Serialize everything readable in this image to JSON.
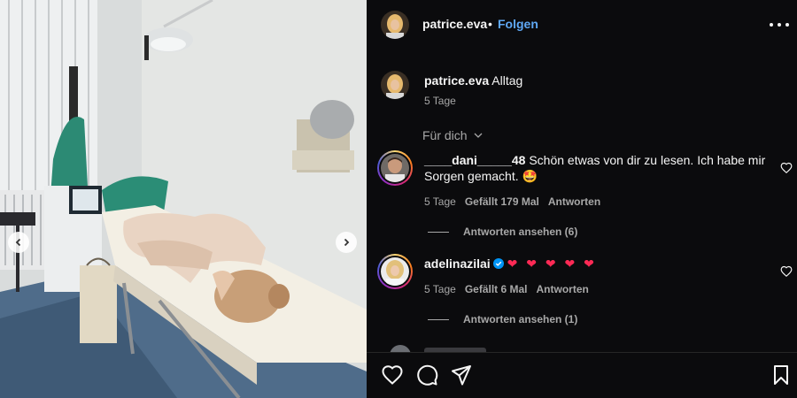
{
  "post": {
    "author": "patrice.eva",
    "follow_label": "Folgen",
    "separator": "•",
    "caption_user": "patrice.eva",
    "caption_text": "Alltag",
    "caption_age": "5 Tage"
  },
  "comments_sort": "Für dich",
  "comments": [
    {
      "user": "____dani_____48",
      "text": "Schön etwas von dir zu lesen. Ich habe mir Sorgen gemacht. 🤩",
      "age": "5 Tage",
      "likes": "Gefällt 179 Mal",
      "reply_label": "Antworten",
      "view_replies": "Antworten ansehen (6)"
    },
    {
      "user": "adelinazilai",
      "verified": true,
      "text": "❤ ❤ ❤ ❤ ❤",
      "age": "5 Tage",
      "likes": "Gefällt 6 Mal",
      "reply_label": "Antworten",
      "view_replies": "Antworten ansehen (1)"
    }
  ],
  "icons": {
    "more": "more-options-icon",
    "like": "heart-icon",
    "comment": "comment-icon",
    "share": "send-icon",
    "save": "bookmark-icon",
    "prev": "chevron-left-icon",
    "next": "chevron-right-icon",
    "verified": "verified-badge-icon",
    "sort": "chevron-down-icon"
  },
  "colors": {
    "background": "#0b0b0d",
    "text": "#f5f5f5",
    "muted": "#a8a8a8",
    "link": "#5fa8f5",
    "verified": "#0095f6",
    "heart": "#ff2a55"
  }
}
